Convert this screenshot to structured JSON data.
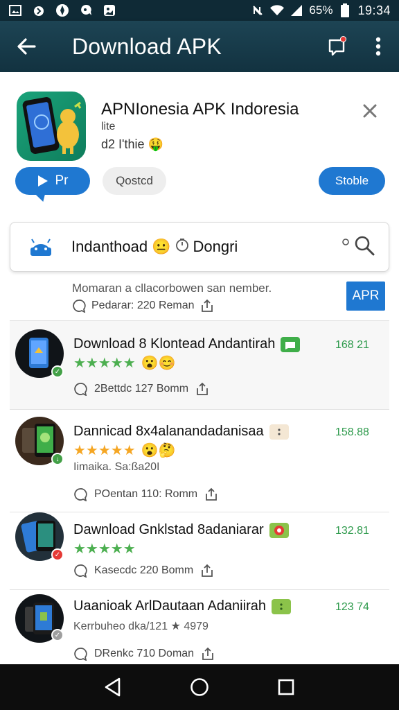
{
  "status_bar": {
    "battery": "65%",
    "time": "19:34",
    "icons": [
      "image-icon",
      "flame-icon",
      "compass-icon",
      "chat-icon",
      "photo-icon",
      "nfc-icon",
      "wifi-icon",
      "signal-icon",
      "battery-icon"
    ]
  },
  "appbar": {
    "title": "Download APK",
    "icons": [
      "back-arrow-icon",
      "notification-icon",
      "overflow-menu-icon"
    ]
  },
  "header": {
    "app_title": "APNIonesia APK Indoresia",
    "sub1": "lite",
    "sub2": "d2 I'thie",
    "sub2_emoji": "🤑",
    "play_label": "Pr",
    "gray_label": "Qostcd",
    "blue_label": "Stoble"
  },
  "search": {
    "text": "Indanthoad",
    "emoji": "😐",
    "text2": "Dongri"
  },
  "intro": {
    "text": "Momaran a cllacorbowen san nember.",
    "meta": "Pedarar: 220  Reman",
    "apk_label": "APR"
  },
  "rows": [
    {
      "title": "Download 8 Klontead Andantirah",
      "version": "168 21",
      "tag_color": "#3fae49",
      "stars": "★★★★★",
      "star_color": "#4caf50",
      "emojis": "😮😊",
      "extra": "",
      "meta": "2Bettdc  127  Bomm",
      "badge_color": "#43a047"
    },
    {
      "title": "Dannicad 8x4alanandadanisaa",
      "version": "158.88",
      "tag_color": "#f4e7d4",
      "stars": "★★★★★",
      "star_color": "#f5a623",
      "emojis": "😮🤔",
      "extra": "Iimaika. Sa:ßa20I",
      "meta": "POentan  110: Romm",
      "badge_color": "#43a047"
    },
    {
      "title": "Dawnload Gnklstad 8adaniarar",
      "version": "132.81",
      "tag_color": "#e53935",
      "stars": "★★★★★",
      "star_color": "#4caf50",
      "emojis": "",
      "extra": "",
      "meta": "Kasecdc  220  Bomm",
      "badge_color": "#e53935"
    },
    {
      "title": "Uaanioak ArlDautaan Adaniirah",
      "version": "123 74",
      "tag_color": "#8bc34a",
      "stars": "",
      "star_color": "#888888",
      "emojis": "",
      "extra": "Kerrbuheo dka/121 ★ 4979",
      "meta": "DRenkc  710  Doman",
      "badge_color": "#9e9e9e"
    }
  ],
  "navbar": {
    "icons": [
      "nav-back-icon",
      "nav-home-icon",
      "nav-recents-icon"
    ]
  },
  "colors": {
    "appbar": "#1d4454",
    "accent_blue": "#1f78d1",
    "version_green": "#2e9a4c"
  }
}
